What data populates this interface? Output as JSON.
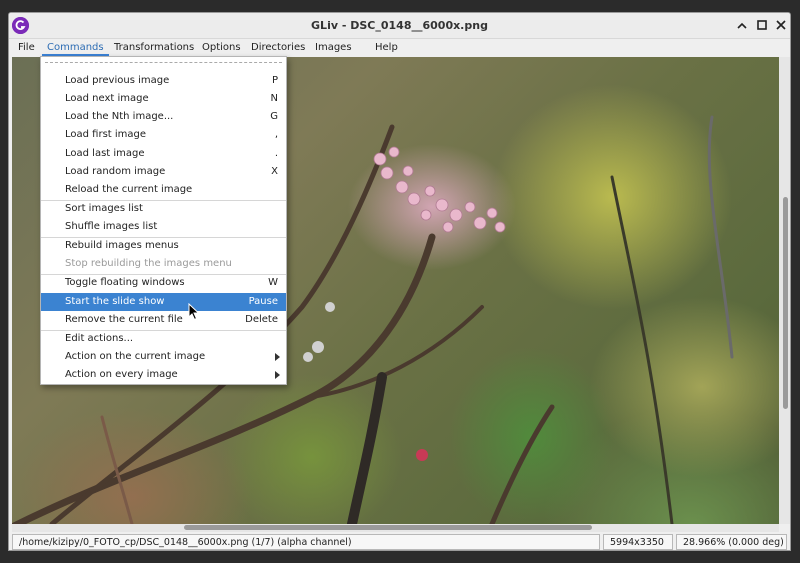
{
  "window": {
    "title": "GLiv - DSC_0148__6000x.png",
    "controls": [
      "minimize-icon",
      "maximize-icon",
      "close-icon"
    ],
    "accent_color": "#3b83d1"
  },
  "menubar": {
    "items": [
      {
        "label": "File"
      },
      {
        "label": "Commands"
      },
      {
        "label": "Transformations"
      },
      {
        "label": "Options"
      },
      {
        "label": "Directories"
      },
      {
        "label": "Images"
      },
      {
        "label": "Help"
      }
    ],
    "active": "Commands"
  },
  "commands_menu": {
    "items": [
      {
        "label": "Load previous image",
        "accel": "P"
      },
      {
        "label": "Load next image",
        "accel": "N"
      },
      {
        "label": "Load the Nth image...",
        "accel": "G"
      },
      {
        "label": "Load first image",
        "accel": ","
      },
      {
        "label": "Load last image",
        "accel": "."
      },
      {
        "label": "Load random image",
        "accel": "X"
      },
      {
        "label": "Reload the current image",
        "accel": ""
      },
      {
        "label": "Sort images list",
        "accel": ""
      },
      {
        "label": "Shuffle images list",
        "accel": ""
      },
      {
        "label": "Rebuild images menus",
        "accel": ""
      },
      {
        "label": "Stop rebuilding the images menu",
        "accel": ""
      },
      {
        "label": "Toggle floating windows",
        "accel": "W"
      },
      {
        "label": "Start the slide show",
        "accel": "Pause"
      },
      {
        "label": "Remove the current file",
        "accel": "Delete"
      },
      {
        "label": "Edit actions...",
        "accel": ""
      },
      {
        "label": "Action on the current image",
        "accel": ""
      },
      {
        "label": "Action on every image",
        "accel": ""
      }
    ]
  },
  "statusbar": {
    "path": "/home/kizipy/0_FOTO_cp/DSC_0148__6000x.png (1/7) (alpha channel)",
    "dimensions": "5994x3350",
    "zoom": "28.966% (0.000 deg)"
  }
}
